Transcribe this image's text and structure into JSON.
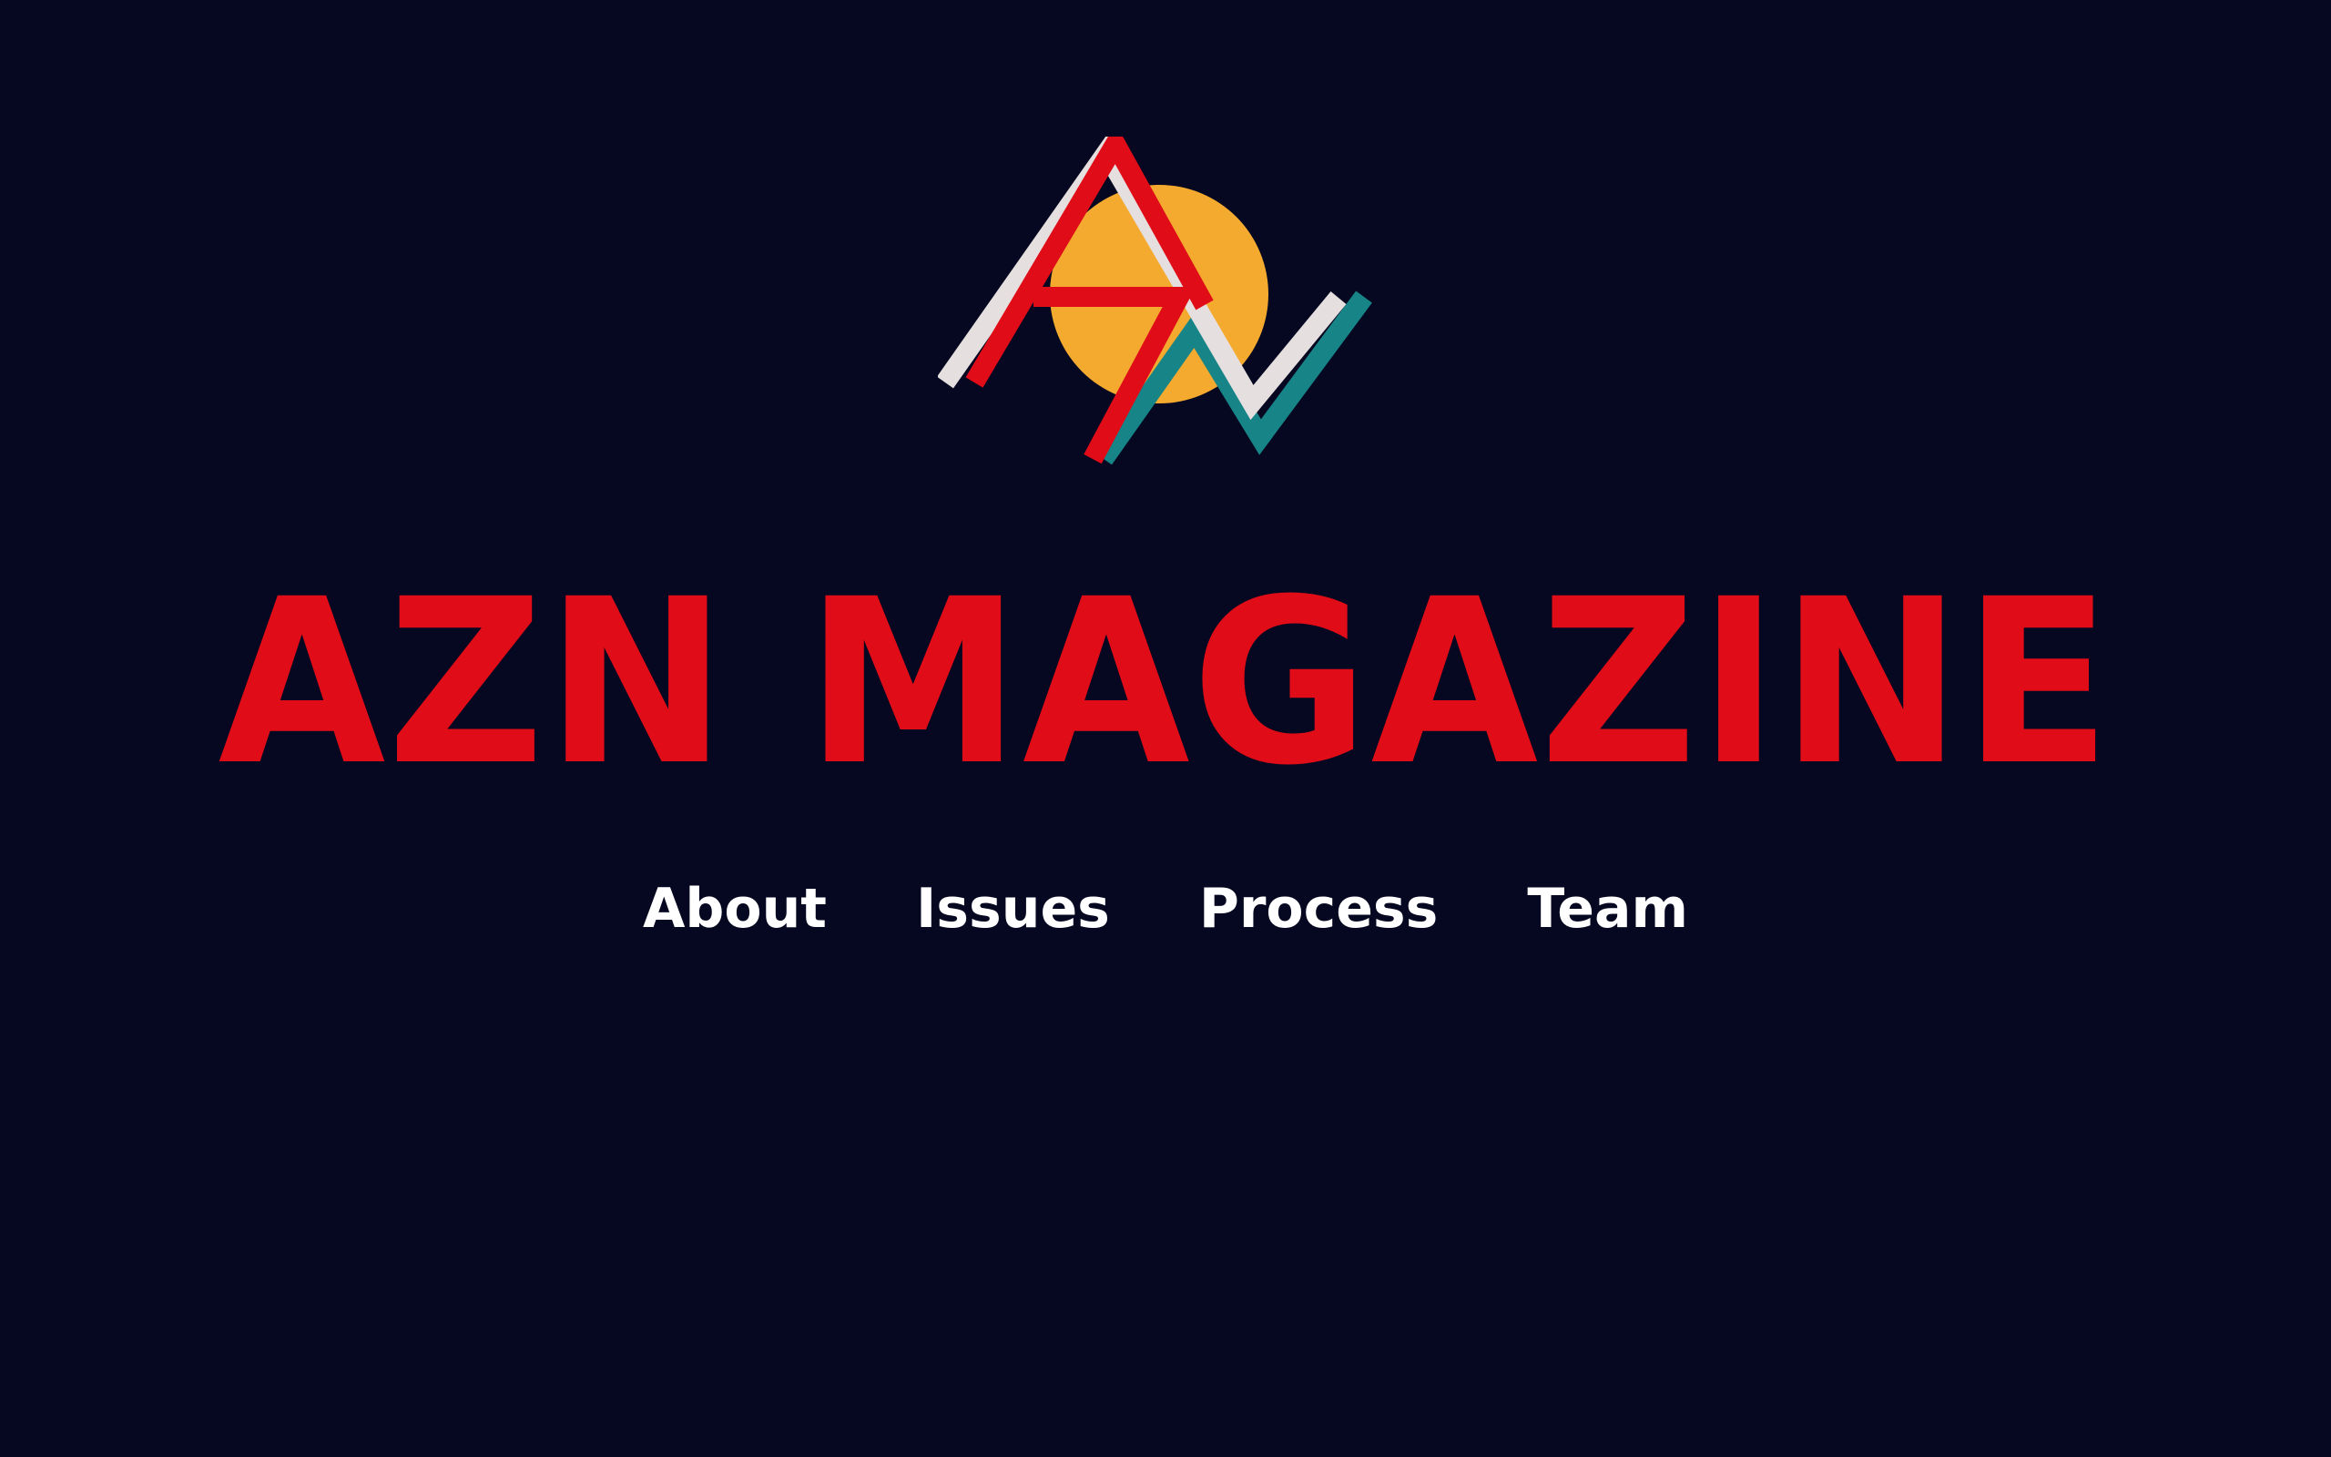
{
  "brand": {
    "title": "AZN MAGAZINE",
    "logo_icon": "azn-mountain-sun-logo",
    "colors": {
      "background": "#050820",
      "red": "#e00c17",
      "sun": "#f4aa2f",
      "white_stripe": "#e6dfdf",
      "teal": "#178488"
    }
  },
  "nav": {
    "items": [
      {
        "label": "About"
      },
      {
        "label": "Issues"
      },
      {
        "label": "Process"
      },
      {
        "label": "Team"
      }
    ]
  }
}
